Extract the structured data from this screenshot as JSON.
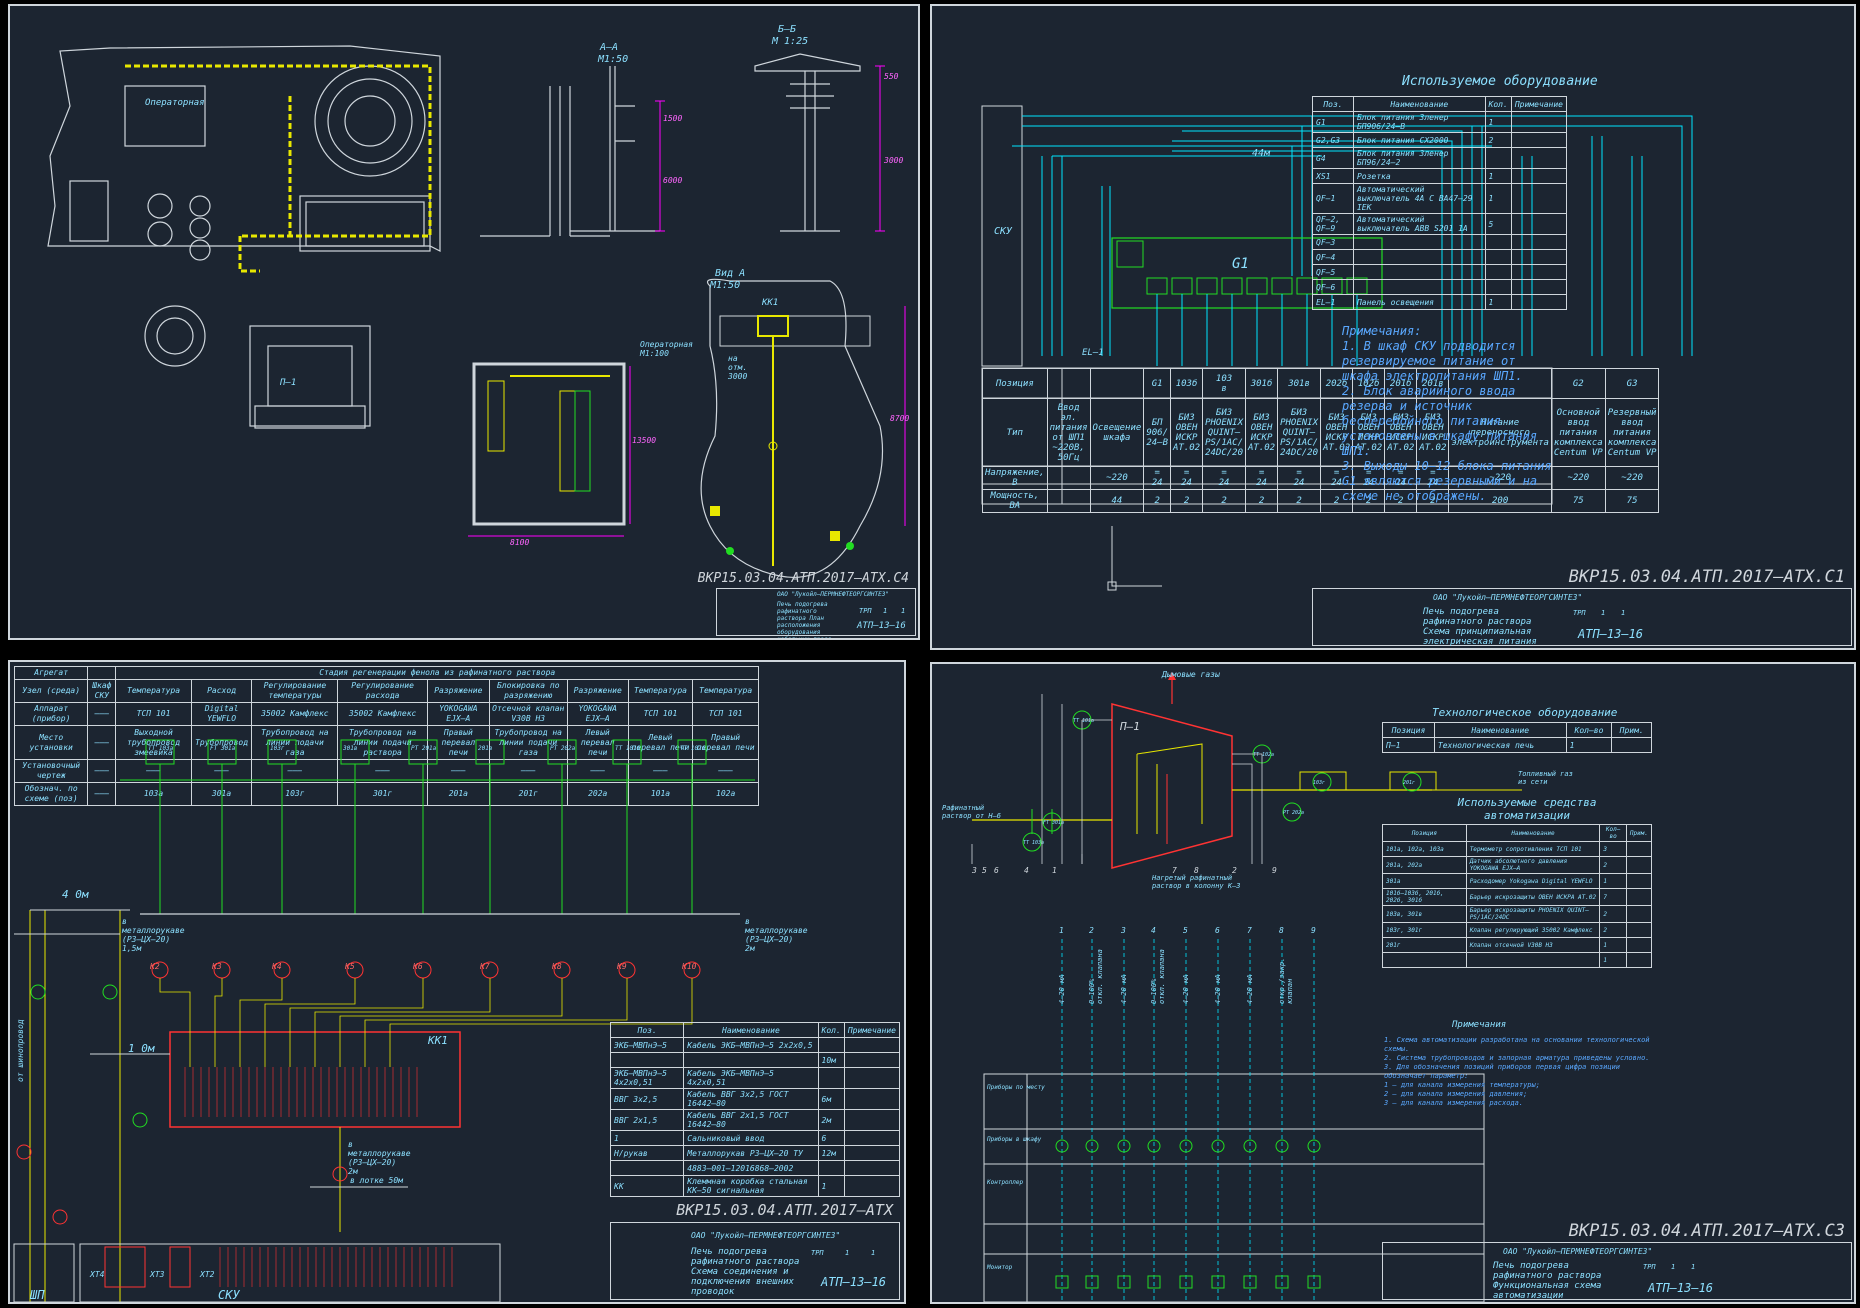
{
  "sheet1": {
    "rooms": {
      "operator_room": "Операторная",
      "operator_room_scale": "Операторная\nМ1:100"
    },
    "section_aa": {
      "title": "А–А",
      "scale": "М1:50",
      "dim1": "1500",
      "dim2": "6000",
      "dim3": "550"
    },
    "section_bb": {
      "title": "Б–Б",
      "scale": "М 1:25",
      "dim1": "550",
      "dim2": "3000"
    },
    "view_a": {
      "title": "Вид А",
      "scale": "М1:50",
      "kk": "КК1",
      "mark": "на\nотм.\n3000",
      "dim": "8700"
    },
    "plan_dims": {
      "d1": "13500",
      "d2": "8100"
    },
    "furnace": "П–1",
    "stamp": {
      "code": "ВКР15.03.04.АТП.2017–АТХ.С4",
      "org": "ОАО \"Лукойл–ПЕРМНЕФТЕОРГСИНТЕЗ\"",
      "title": "Печь подогрева рафинатного раствора План расположения оборудования кабельных трасс",
      "stage": "ТРП",
      "sheet": "1",
      "sheets": "1",
      "group": "АТП–13–16"
    }
  },
  "sheet2": {
    "panel_label": "СКУ",
    "bus_length": "44м",
    "g1_label": "G1",
    "el1": "EL–1",
    "table_headers": [
      "Позиция",
      "Тип",
      "Напряжение, В",
      "Мощность, ВА"
    ],
    "columns": [
      {
        "pos": "",
        "type": "Ввод эл. питания от ШП1 ~220В, 50Гц",
        "v": "",
        "p": ""
      },
      {
        "pos": "",
        "type": "Освещение шкафа",
        "v": "~220",
        "p": "44"
      },
      {
        "pos": "G1",
        "type": "БП 906/ 24–В",
        "v": "=\n24",
        "p": "2"
      },
      {
        "pos": "103б",
        "type": "БИЗ ОВЕН ИСКР АТ.02",
        "v": "=\n24",
        "p": "2"
      },
      {
        "pos": "103\nв",
        "type": "БИЗ PHOENIX QUINT–PS/1AC/ 24DC/20",
        "v": "=\n24",
        "p": "2"
      },
      {
        "pos": "301б",
        "type": "БИЗ ОВЕН ИСКР АТ.02",
        "v": "=\n24",
        "p": "2"
      },
      {
        "pos": "301в",
        "type": "БИЗ PHOENIX QUINT–PS/1AC/ 24DC/20",
        "v": "=\n24",
        "p": "2"
      },
      {
        "pos": "202б",
        "type": "БИЗ ОВЕН ИСКР АТ.02",
        "v": "=\n24",
        "p": "2"
      },
      {
        "pos": "102б",
        "type": "БИЗ ОВЕН ИСКР АТ.02",
        "v": "=\n24",
        "p": "2"
      },
      {
        "pos": "201б",
        "type": "БИЗ ОВЕН ИСКР АТ.02",
        "v": "=\n24",
        "p": "2"
      },
      {
        "pos": "201в",
        "type": "БИЗ ОВЕН ИСКР АТ.02",
        "v": "=\n24",
        "p": "2"
      },
      {
        "pos": "",
        "type": "Питание переносного электроинструмента",
        "v": "~220",
        "p": "200"
      },
      {
        "pos": "G2",
        "type": "Основной ввод питания комплекса Centum VP",
        "v": "~220",
        "p": "75"
      },
      {
        "pos": "G3",
        "type": "Резервный ввод питания комплекса Centum VP",
        "v": "~220",
        "p": "75"
      }
    ],
    "equip_title": "Используемое оборудование",
    "equip_headers": [
      "Поз.",
      "Наименование",
      "Кол.",
      "Примечание"
    ],
    "equip_rows": [
      [
        "G1",
        "Блок питания Зленер БП906/24–В",
        "1",
        ""
      ],
      [
        "G2,G3",
        "Блок питания CX2000",
        "2",
        ""
      ],
      [
        "G4",
        "Блок питания Зленер БП96/24–2",
        "",
        ""
      ],
      [
        "XS1",
        "Розетка",
        "1",
        ""
      ],
      [
        "QF–1",
        "Автоматический выключатель 4А С ВА47–29 IEK",
        "1",
        ""
      ],
      [
        "QF–2, QF–9",
        "Автоматический выключатель ABB S201 1A",
        "5",
        ""
      ],
      [
        "QF–3",
        "",
        "",
        ""
      ],
      [
        "QF–4",
        "",
        "",
        ""
      ],
      [
        "QF–5",
        "",
        "",
        ""
      ],
      [
        "QF–6",
        "",
        "",
        ""
      ],
      [
        "EL–1",
        "Панель освещения",
        "1",
        ""
      ]
    ],
    "notes_title": "Примечания:",
    "notes": [
      "1. В шкаф СКУ подводится резервируемое питание от шкафа электропитания ШП1.",
      "2. Блок аварийного ввода резерва и источник бесперебойного питания установлены в шкафу питания ШП1.",
      "3. Выходы 10–12 блока питания G1 являются резервными и на схеме не отображены."
    ],
    "stamp": {
      "code": "ВКР15.03.04.АТП.2017–АТХ.С1",
      "org": "ОАО \"Лукойл–ПЕРМНЕФТЕОРГСИНТЕЗ\"",
      "title": "Печь подогрева рафинатного раствора Схема принципиальная электрическая питания",
      "stage": "ТРП",
      "sheet": "1",
      "sheets": "1",
      "group": "АТП–13–16"
    }
  },
  "sheet3": {
    "header_left": [
      "Агрегат",
      "Узел (среда)",
      "Аппарат (прибор)",
      "Место установки",
      "Установочный чертеж",
      "Обознач. по схеме (поз)"
    ],
    "stage_title": "Стадия регенерации фенола из рафинатного раствора",
    "cabinet": "Шкаф СКУ",
    "columns": [
      {
        "node": "Температура",
        "device": "ТСП 101",
        "place": "Выходной трубопровод змеевика",
        "draw": "–––",
        "pos": "103а"
      },
      {
        "node": "Расход",
        "device": "Digital YEWFLO",
        "place": "Трубопровод",
        "draw": "–––",
        "pos": "301а"
      },
      {
        "node": "Регулирование температуры",
        "device": "35002 Камфлекс",
        "place": "Трубопровод на линии подачи газа",
        "draw": "–––",
        "pos": "103г"
      },
      {
        "node": "Регулирование расхода",
        "device": "35002 Камфлекс",
        "place": "Трубопровод на линии подачи раствора",
        "draw": "–––",
        "pos": "301г"
      },
      {
        "node": "Разряжение",
        "device": "YOKOGAWA EJX–A",
        "place": "Правый перевал печи",
        "draw": "–––",
        "pos": "201а"
      },
      {
        "node": "Блокировка по разряжению",
        "device": "Отсечной клапан V30В НЗ",
        "place": "Трубопровод на линии подачи газа",
        "draw": "–––",
        "pos": "201г"
      },
      {
        "node": "Разряжение",
        "device": "YOKOGAWA EJX–A",
        "place": "Левый перевал печи",
        "draw": "–––",
        "pos": "202а"
      },
      {
        "node": "Температура",
        "device": "ТСП 101",
        "place": "Левый перевал печи",
        "draw": "–––",
        "pos": "101а"
      },
      {
        "node": "Температура",
        "device": "ТСП 101",
        "place": "Правый перевал печи",
        "draw": "–––",
        "pos": "102а"
      }
    ],
    "devices": [
      "ТТ 103а",
      "FT 301а",
      "103г",
      "301в",
      "PT 201а",
      "201в",
      "PT 202а",
      "ТТ 101а",
      "ТТ 102а"
    ],
    "cable_labels": [
      "К2",
      "К3",
      "К4",
      "К5",
      "К6",
      "К7",
      "К8",
      "К9",
      "К10"
    ],
    "junction": "КК1",
    "dist_4m": "4 0м",
    "dist_1m": "1 0м",
    "metal_left": "в\nметаллорукаве\n(РЗ–ЦХ–20)\n1,5м",
    "metal_right": "в\nметаллорукаве\n(РЗ–ЦХ–20)\n2м",
    "metal_bottom": "в\nметаллорукаве\n(РЗ–ЦХ–20)\n2м",
    "tray": "в лотке 50м",
    "from_shp": "от шинопровод",
    "bottom_left": "ШП",
    "bottom_right": "СКУ",
    "xt": [
      "ХТ4",
      "ХТ3",
      "ХТ2"
    ],
    "spec_headers": [
      "Поз.",
      "Наименование",
      "Кол.",
      "Примечание"
    ],
    "spec_rows": [
      [
        "ЭКБ–МВПнЭ–5",
        "Кабель ЭКБ–МВПнЭ–5 2х2х0,5",
        "",
        ""
      ],
      [
        "",
        "",
        "10м",
        ""
      ],
      [
        "ЭКБ–МВПнЭ–5 4х2х0,51",
        "Кабель ЭКБ–МВПнЭ–5 4х2х0,51",
        "",
        ""
      ],
      [
        "ВВГ 3х2,5",
        "Кабель ВВГ 3х2,5 ГОСТ 16442–80",
        "6м",
        ""
      ],
      [
        "ВВГ 2х1,5",
        "Кабель ВВГ 2х1,5 ГОСТ 16442–80",
        "2м",
        ""
      ],
      [
        "1",
        "Сальниковый ввод",
        "6",
        ""
      ],
      [
        "Н/рукав",
        "Металлорукав РЗ–ЦХ–20 ТУ",
        "12м",
        ""
      ],
      [
        "",
        "4883–001–12016868–2002",
        "",
        ""
      ],
      [
        "КК",
        "Клеммная коробка стальная КК–50 сигнальная",
        "1",
        ""
      ]
    ],
    "stamp": {
      "code": "ВКР15.03.04.АТП.2017–АТХ",
      "org": "ОАО \"Лукойл–ПЕРМНЕФТЕОРГСИНТЕЗ\"",
      "title": "Печь подогрева рафинатного раствора Схема соединения и подключения внешних проводок",
      "stage": "ТРП",
      "sheet": "1",
      "sheets": "1",
      "group": "АТП–13–16"
    }
  },
  "sheet4": {
    "furnace": "П–1",
    "flue_gas": "Дымовые газы",
    "raffinate_in": "Рафинатный раствор от Н–6",
    "fuel_gas": "Топливный газ из сети",
    "heated_out": "Нагретый рафинатный раствор в колонну К–3",
    "instruments": [
      "ТТ 101а",
      "ТТ 102а",
      "PT 202а",
      "FT 301а",
      "ТТ 103а",
      "103г",
      "201г"
    ],
    "line_numbers": [
      "3",
      "5",
      "6",
      "4",
      "1",
      "7",
      "8",
      "2",
      "9"
    ],
    "signal_numbers": [
      "1",
      "2",
      "3",
      "4",
      "5",
      "6",
      "7",
      "8",
      "9"
    ],
    "signals": [
      "4–20 мА",
      "0–100%\nоткл. клапана",
      "4–20 мА",
      "0–100%\nоткл. клапана",
      "4–20 мА",
      "4–20 мА",
      "4–20 мА",
      "откр./закр.\nклапан",
      ""
    ],
    "rows": [
      "Приборы по месту",
      "Приборы в шкафу",
      "Контроллер",
      "Монитор"
    ],
    "tech_title": "Технологическое оборудование",
    "tech_headers": [
      "Позиция",
      "Наименование",
      "Кол–во",
      "Прим."
    ],
    "tech_rows": [
      [
        "П–1",
        "Технологическая печь",
        "1",
        ""
      ]
    ],
    "auto_title": "Используемые средства автоматизации",
    "auto_headers": [
      "Позиция",
      "Наименование",
      "Кол–во",
      "Прим."
    ],
    "auto_rows": [
      [
        "101а, 102а, 103а",
        "Термометр сопротивления ТСП 101",
        "3",
        ""
      ],
      [
        "201а, 202а",
        "Датчик абсолютного давления YOKOGAWA EJX–A",
        "2",
        ""
      ],
      [
        "301а",
        "Расходомер Yokogawa Digital YEWFLO",
        "1",
        ""
      ],
      [
        "101б–103б, 201б, 202б, 301б",
        "Барьер искрозащиты ОВЕН ИСКРА АТ.02",
        "7",
        ""
      ],
      [
        "103в, 301в",
        "Барьер искрозащиты PHOENIX QUINT–PS/1AC/24DC",
        "2",
        ""
      ],
      [
        "103г, 301г",
        "Клапан регулирующий 35002 Камфлекс",
        "2",
        ""
      ],
      [
        "201г",
        "Клапан отсечной V30В НЗ",
        "1",
        ""
      ],
      [
        "",
        "",
        "1",
        ""
      ]
    ],
    "notes_title": "Примечания",
    "notes": [
      "1. Схема автоматизации разработана на основании технологической схемы.",
      "2. Система трубопроводов и запорная арматура приведены условно.",
      "3. Для обозначения позиций приборов первая цифра позиции обозначает параметр:",
      "   1 – для канала измерения температуры;",
      "   2 – для канала измерения давления;",
      "   3 – для канала измерения расхода."
    ],
    "stamp": {
      "code": "ВКР15.03.04.АТП.2017–АТХ.С3",
      "org": "ОАО \"Лукойл–ПЕРМНЕФТЕОРГСИНТЕЗ\"",
      "title": "Печь подогрева рафинатного раствора Функциональная схема автоматизации",
      "stage": "ТРП",
      "sheet": "1",
      "sheets": "1",
      "group": "АТП–13–16"
    }
  },
  "colors": {
    "sheet_bg": "#1c2531",
    "cyan": "#00e5ff",
    "yellow": "#e8e800",
    "magenta": "#ff00ff",
    "green": "#22dd22",
    "red": "#ff3333",
    "white": "#cfd6dc"
  }
}
